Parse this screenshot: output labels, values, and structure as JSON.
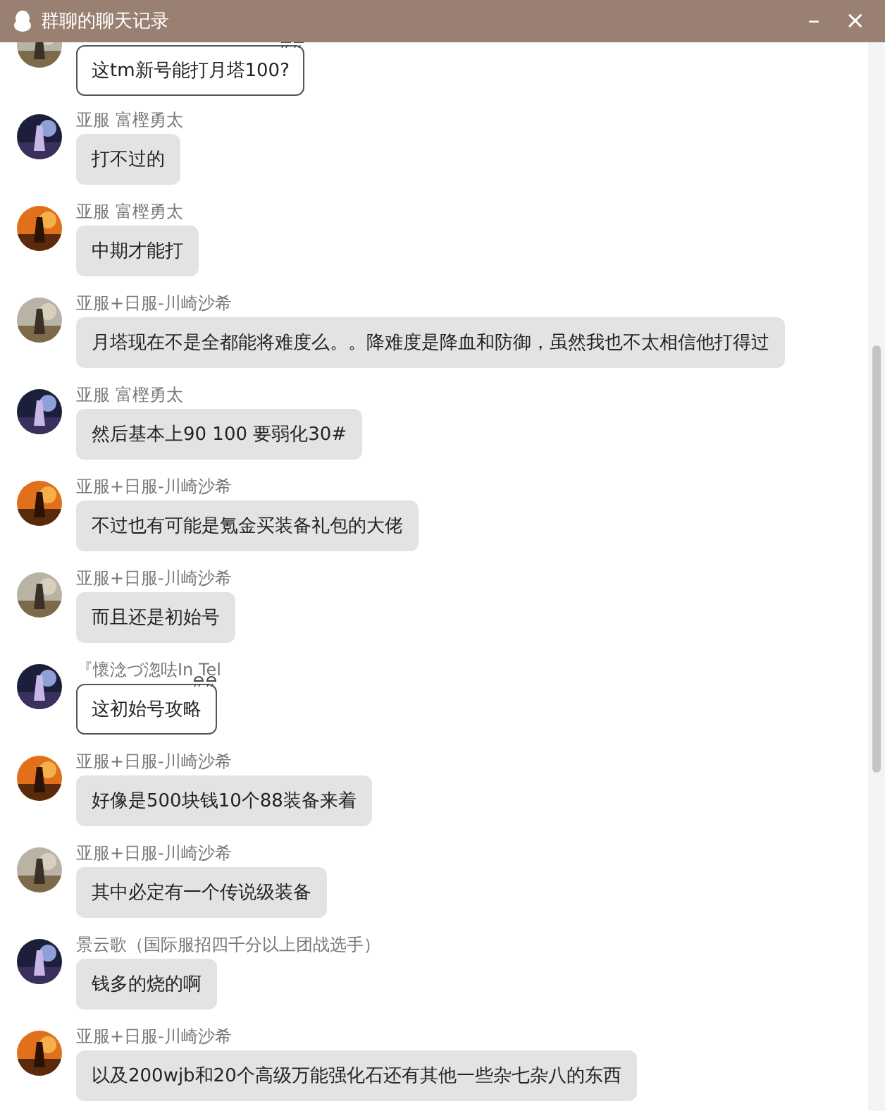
{
  "window": {
    "title": "群聊的聊天记录",
    "controls": [
      "–",
      "×"
    ]
  },
  "messages": [
    {
      "kind": "outlined",
      "text": "这tm新号能打月塔100?"
    },
    {
      "name": "亚服 富樫勇太",
      "kind": "plain",
      "text": "打不过的"
    },
    {
      "name": "亚服 富樫勇太",
      "kind": "plain",
      "text": "中期才能打"
    },
    {
      "name": "亚服+日服-川崎沙希",
      "kind": "plain",
      "text": "月塔现在不是全都能将难度么。。降难度是降血和防御，虽然我也不太相信他打得过"
    },
    {
      "name": "亚服 富樫勇太",
      "kind": "plain",
      "text": "然后基本上90 100 要弱化30#"
    },
    {
      "name": "亚服+日服-川崎沙希",
      "kind": "plain",
      "text": "不过也有可能是氪金买装备礼包的大佬"
    },
    {
      "name": "亚服+日服-川崎沙希",
      "kind": "plain",
      "text": "而且还是初始号"
    },
    {
      "name": "『懷淰づ淴呿In Tel",
      "kind": "outlined",
      "text": "这初始号攻略"
    },
    {
      "name": "亚服+日服-川崎沙希",
      "kind": "plain",
      "text": "好像是500块钱10个88装备来着"
    },
    {
      "name": "亚服+日服-川崎沙希",
      "kind": "plain",
      "text": "其中必定有一个传说级装备"
    },
    {
      "name": "景云歌（国际服招四千分以上团战选手）",
      "kind": "plain",
      "text": "钱多的烧的啊"
    },
    {
      "name": "亚服+日服-川崎沙希",
      "kind": "plain",
      "text": "以及200wjb和20个高级万能强化石还有其他一些杂七杂八的东西"
    }
  ]
}
